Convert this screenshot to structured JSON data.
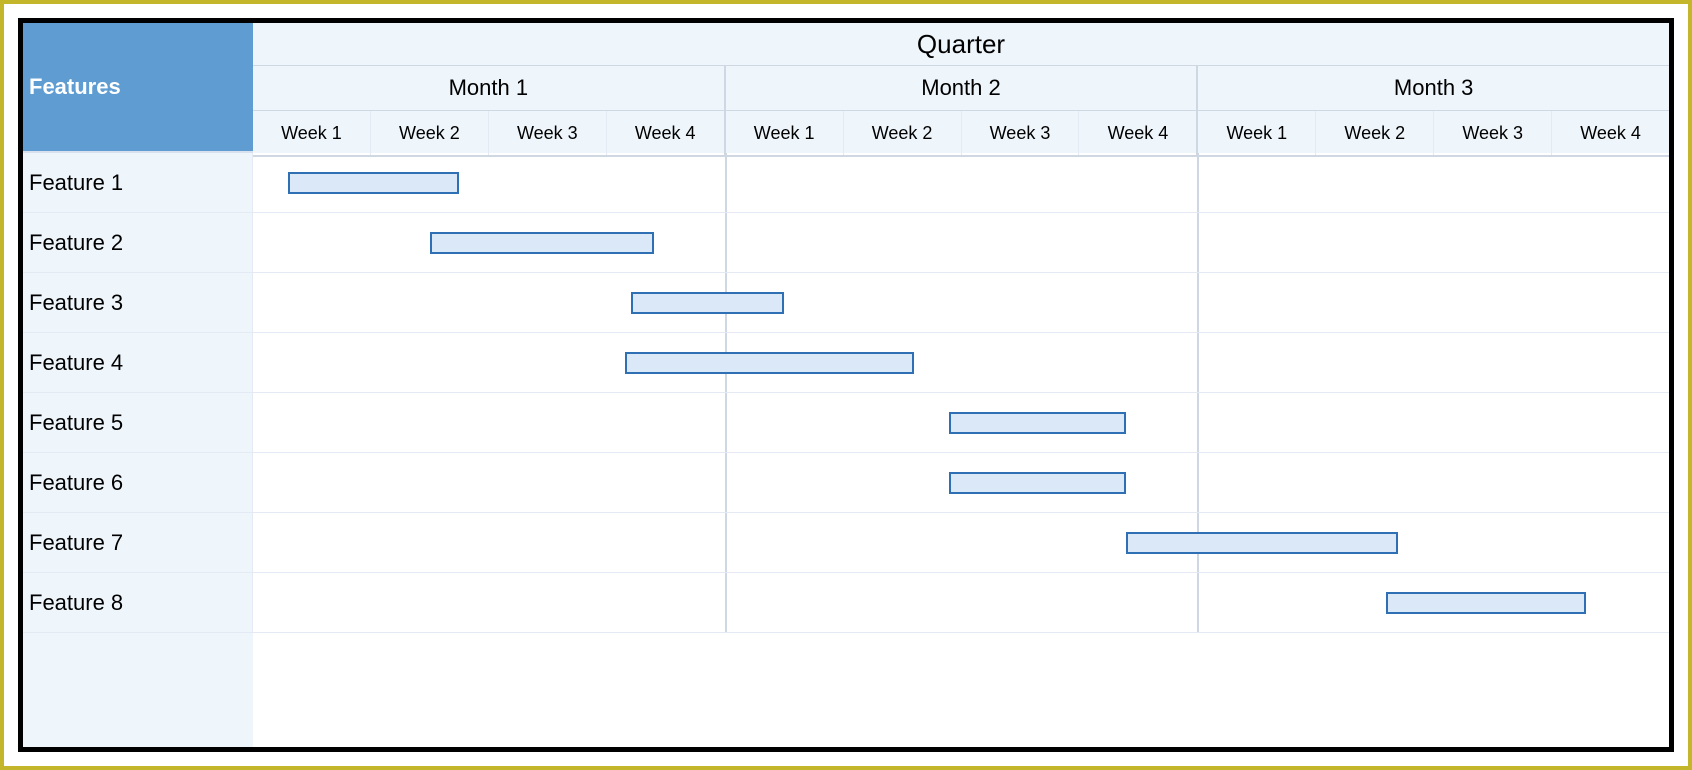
{
  "header": {
    "features_label": "Features",
    "quarter_label": "Quarter",
    "months": [
      "Month 1",
      "Month 2",
      "Month 3"
    ],
    "weeks": [
      "Week 1",
      "Week 2",
      "Week 3",
      "Week 4",
      "Week 1",
      "Week 2",
      "Week 3",
      "Week 4",
      "Week 1",
      "Week 2",
      "Week 3",
      "Week 4"
    ]
  },
  "rows": [
    {
      "label": "Feature 1"
    },
    {
      "label": "Feature 2"
    },
    {
      "label": "Feature 3"
    },
    {
      "label": "Feature 4"
    },
    {
      "label": "Feature 5"
    },
    {
      "label": "Feature 6"
    },
    {
      "label": "Feature 7"
    },
    {
      "label": "Feature 8"
    }
  ],
  "chart_data": {
    "type": "bar",
    "title": "Quarter",
    "xlabel": "",
    "ylabel": "Features",
    "x_unit": "week",
    "x_range": [
      0,
      12
    ],
    "categories": [
      "Feature 1",
      "Feature 2",
      "Feature 3",
      "Feature 4",
      "Feature 5",
      "Feature 6",
      "Feature 7",
      "Feature 8"
    ],
    "series": [
      {
        "name": "Feature 1",
        "start_week": 0.3,
        "end_week": 1.75
      },
      {
        "name": "Feature 2",
        "start_week": 1.5,
        "end_week": 3.4
      },
      {
        "name": "Feature 3",
        "start_week": 3.2,
        "end_week": 4.5
      },
      {
        "name": "Feature 4",
        "start_week": 3.15,
        "end_week": 5.6
      },
      {
        "name": "Feature 5",
        "start_week": 5.9,
        "end_week": 7.4
      },
      {
        "name": "Feature 6",
        "start_week": 5.9,
        "end_week": 7.4
      },
      {
        "name": "Feature 7",
        "start_week": 7.4,
        "end_week": 9.7
      },
      {
        "name": "Feature 8",
        "start_week": 9.6,
        "end_week": 11.3
      }
    ]
  },
  "colors": {
    "header_bg": "#eef5fb",
    "features_bg": "#5e9cd2",
    "bar_fill": "#dbe8f7",
    "bar_border": "#2f6fb4",
    "grid_line": "#cfd7e2",
    "outer_border": "#c3b62a"
  }
}
